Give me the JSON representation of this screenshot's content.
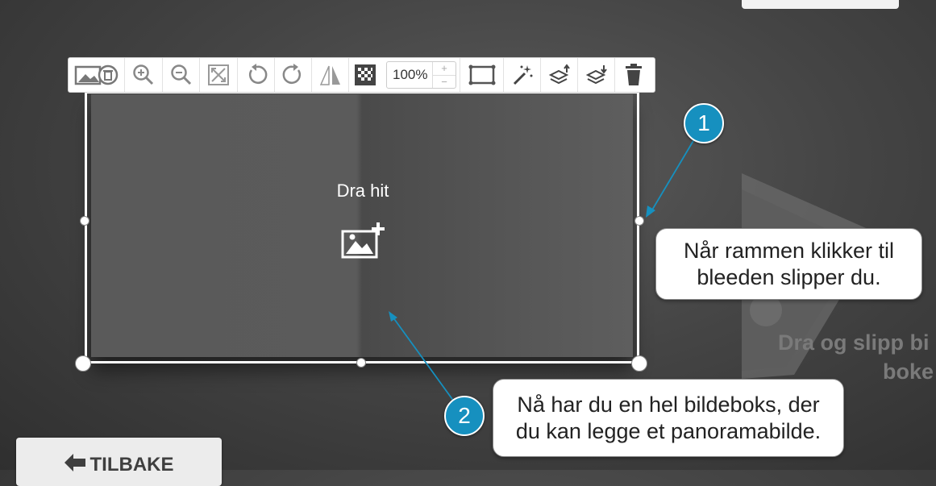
{
  "toolbar": {
    "zoom_value": "100%",
    "stepper_up": "+",
    "stepper_down": "−"
  },
  "photobox": {
    "drop_label": "Dra hit"
  },
  "right_page": {
    "ghost_line1": "Dra og slipp bi",
    "ghost_line2": "boke"
  },
  "callouts": [
    {
      "number": "1",
      "line1": "Når rammen klikker til",
      "line2": "bleeden slipper du."
    },
    {
      "number": "2",
      "line1": "Nå har du en hel bildeboks, der",
      "line2": "du kan legge et panoramabilde."
    }
  ],
  "back_button": {
    "label": "TILBAKE"
  },
  "colors": {
    "accent": "#1690bf",
    "background": "#454545"
  },
  "icons": [
    "image-delete-icon",
    "zoom-in-icon",
    "zoom-out-icon",
    "fit-icon",
    "rotate-left-icon",
    "rotate-right-icon",
    "flip-icon",
    "transparency-icon",
    "frame-icon",
    "magic-wand-icon",
    "layer-up-icon",
    "layer-down-icon",
    "trash-icon",
    "image-add-icon",
    "back-arrow-icon"
  ]
}
